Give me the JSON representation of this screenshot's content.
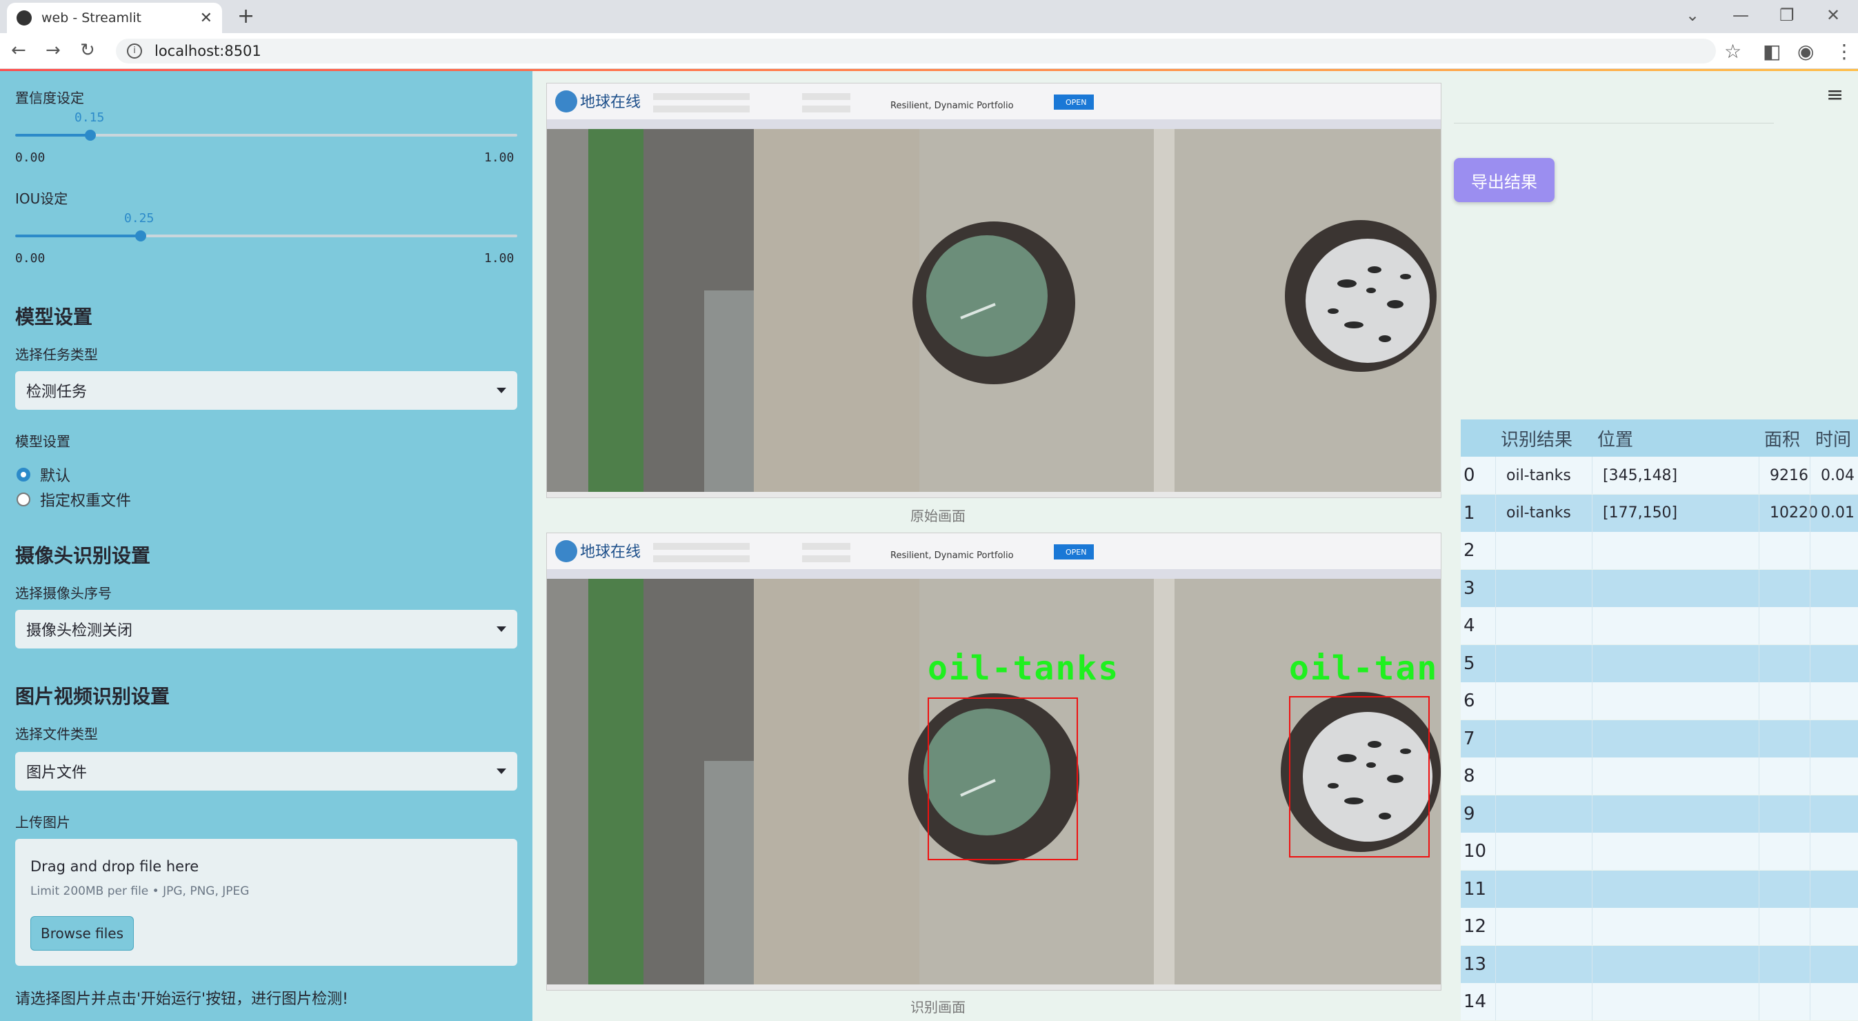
{
  "browser": {
    "tab_title": "web - Streamlit",
    "url": "localhost:8501"
  },
  "sidebar": {
    "confidence": {
      "label": "置信度设定",
      "value": "0.15",
      "min": "0.00",
      "max": "1.00",
      "fraction": 0.15
    },
    "iou": {
      "label": "IOU设定",
      "value": "0.25",
      "min": "0.00",
      "max": "1.00",
      "fraction": 0.25
    },
    "model_section": "模型设置",
    "task_type_label": "选择任务类型",
    "task_type_value": "检测任务",
    "model_label": "模型设置",
    "model_options": [
      "默认",
      "指定权重文件"
    ],
    "model_selected": "默认",
    "camera_section": "摄像头识别设置",
    "camera_label": "选择摄像头序号",
    "camera_value": "摄像头检测关闭",
    "media_section": "图片视频识别设置",
    "file_type_label": "选择文件类型",
    "file_type_value": "图片文件",
    "upload_label": "上传图片",
    "upload_drag": "Drag and drop file here",
    "upload_limit": "Limit 200MB per file • JPG, PNG, JPEG",
    "browse_label": "Browse files",
    "hint": "请选择图片并点击'开始运行'按钮，进行图片检测!"
  },
  "main": {
    "original_caption": "原始画面",
    "result_caption": "识别画面",
    "detection_label": "oil-tanks",
    "export_label": "导出结果",
    "site_logo_text": "地球在线",
    "ad_text": "Resilient, Dynamic Portfolio",
    "ad_button": "OPEN"
  },
  "table": {
    "columns": [
      "识别结果",
      "位置",
      "面积",
      "时间"
    ],
    "rows": [
      {
        "idx": "0",
        "result": "oil-tanks",
        "pos": "[345,148]",
        "area": "9216",
        "time": "0.04"
      },
      {
        "idx": "1",
        "result": "oil-tanks",
        "pos": "[177,150]",
        "area": "10220",
        "time": "0.01"
      },
      {
        "idx": "2",
        "result": "",
        "pos": "",
        "area": "",
        "time": ""
      },
      {
        "idx": "3",
        "result": "",
        "pos": "",
        "area": "",
        "time": ""
      },
      {
        "idx": "4",
        "result": "",
        "pos": "",
        "area": "",
        "time": ""
      },
      {
        "idx": "5",
        "result": "",
        "pos": "",
        "area": "",
        "time": ""
      },
      {
        "idx": "6",
        "result": "",
        "pos": "",
        "area": "",
        "time": ""
      },
      {
        "idx": "7",
        "result": "",
        "pos": "",
        "area": "",
        "time": ""
      },
      {
        "idx": "8",
        "result": "",
        "pos": "",
        "area": "",
        "time": ""
      },
      {
        "idx": "9",
        "result": "",
        "pos": "",
        "area": "",
        "time": ""
      },
      {
        "idx": "10",
        "result": "",
        "pos": "",
        "area": "",
        "time": ""
      },
      {
        "idx": "11",
        "result": "",
        "pos": "",
        "area": "",
        "time": ""
      },
      {
        "idx": "12",
        "result": "",
        "pos": "",
        "area": "",
        "time": ""
      },
      {
        "idx": "13",
        "result": "",
        "pos": "",
        "area": "",
        "time": ""
      },
      {
        "idx": "14",
        "result": "",
        "pos": "",
        "area": "",
        "time": ""
      }
    ]
  },
  "colors": {
    "sidebar": "#7ec9dc",
    "accent": "#2c8ac9",
    "export": "#9b8ef0",
    "box": "#ee1111",
    "label": "#1ff01f"
  }
}
